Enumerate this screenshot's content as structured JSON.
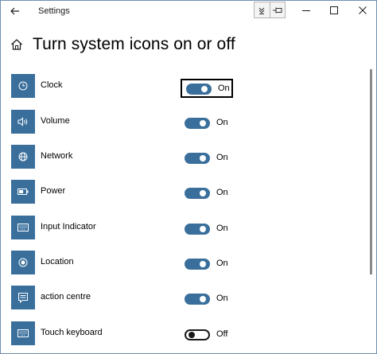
{
  "window": {
    "title": "Settings"
  },
  "header": {
    "title": "Turn system icons on or off"
  },
  "items": [
    {
      "label": "Clock",
      "icon": "clock-icon",
      "state": "On",
      "on": true,
      "focused": true
    },
    {
      "label": "Volume",
      "icon": "volume-icon",
      "state": "On",
      "on": true,
      "focused": false
    },
    {
      "label": "Network",
      "icon": "globe-icon",
      "state": "On",
      "on": true,
      "focused": false
    },
    {
      "label": "Power",
      "icon": "battery-icon",
      "state": "On",
      "on": true,
      "focused": false
    },
    {
      "label": "Input Indicator",
      "icon": "keyboard-icon",
      "state": "On",
      "on": true,
      "focused": false
    },
    {
      "label": "Location",
      "icon": "location-icon",
      "state": "On",
      "on": true,
      "focused": false
    },
    {
      "label": "action centre",
      "icon": "action-centre-icon",
      "state": "On",
      "on": true,
      "focused": false
    },
    {
      "label": "Touch keyboard",
      "icon": "touch-keyboard-icon",
      "state": "Off",
      "on": false,
      "focused": false
    }
  ],
  "colors": {
    "accent": "#3a6f9c",
    "toggle_off_border": "#1a1a1a"
  }
}
